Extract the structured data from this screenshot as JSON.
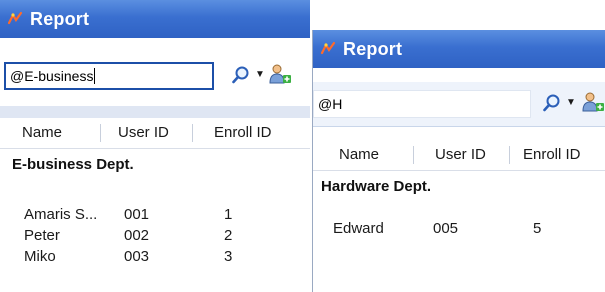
{
  "colors": {
    "titlebar": "#3a6fd0",
    "title_text": "#ffffff",
    "search_border": "#1c4fa8"
  },
  "panels": [
    {
      "title": "Report",
      "search_value": "@E-business",
      "columns": [
        "Name",
        "User ID",
        "Enroll ID"
      ],
      "group": "E-business Dept.",
      "rows": [
        {
          "name": "Amaris S...",
          "user_id": "001",
          "enroll_id": "1"
        },
        {
          "name": "Peter",
          "user_id": "002",
          "enroll_id": "2"
        },
        {
          "name": "Miko",
          "user_id": "003",
          "enroll_id": "3"
        }
      ]
    },
    {
      "title": "Report",
      "search_value": "@H",
      "columns": [
        "Name",
        "User ID",
        "Enroll ID"
      ],
      "group": "Hardware Dept.",
      "rows": [
        {
          "name": "Edward",
          "user_id": "005",
          "enroll_id": "5"
        }
      ]
    }
  ]
}
